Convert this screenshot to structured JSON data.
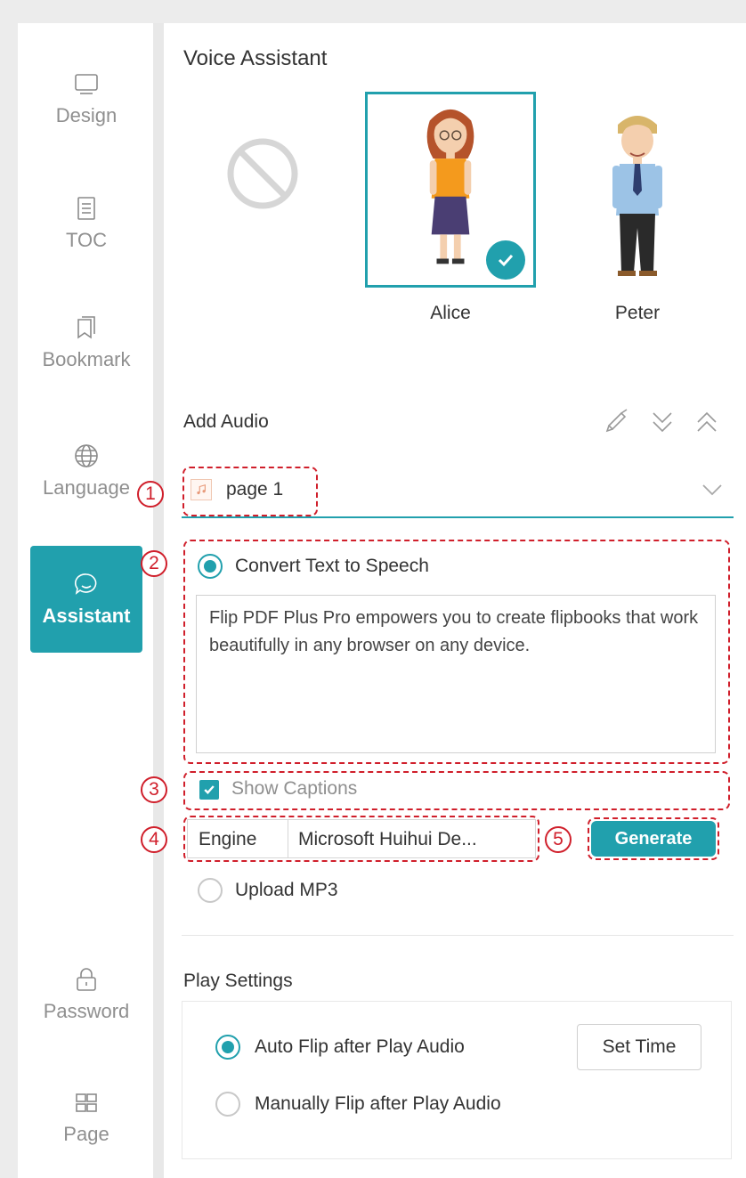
{
  "sidebar": {
    "items": [
      {
        "label": "Design",
        "icon": "monitor-icon"
      },
      {
        "label": "TOC",
        "icon": "toc-icon"
      },
      {
        "label": "Bookmark",
        "icon": "bookmark-icon"
      },
      {
        "label": "Language",
        "icon": "globe-icon"
      },
      {
        "label": "Assistant",
        "icon": "chat-bubble-icon",
        "active": true
      },
      {
        "label": "Password",
        "icon": "lock-icon"
      },
      {
        "label": "Page",
        "icon": "grid-icon"
      }
    ]
  },
  "voice_assistant": {
    "title": "Voice Assistant",
    "avatars": [
      {
        "name": "",
        "icon": "no-assistant-icon"
      },
      {
        "name": "Alice",
        "selected": true
      },
      {
        "name": "Peter"
      }
    ]
  },
  "add_audio": {
    "title": "Add Audio",
    "tools": [
      "broom-icon",
      "expand-all-icon",
      "collapse-all-icon"
    ],
    "page_select": {
      "value": "page 1",
      "icon": "music-note-icon"
    },
    "tts": {
      "label": "Convert Text to Speech",
      "selected": true,
      "text": "Flip PDF Plus Pro empowers you to create flipbooks that work beautifully in any browser on any device."
    },
    "show_captions": {
      "label": "Show Captions",
      "checked": true
    },
    "engine": {
      "label": "Engine",
      "value": "Microsoft Huihui De..."
    },
    "generate_label": "Generate",
    "upload_mp3": {
      "label": "Upload MP3",
      "selected": false
    }
  },
  "play_settings": {
    "title": "Play Settings",
    "options": [
      {
        "label": "Auto Flip after Play Audio",
        "selected": true
      },
      {
        "label": "Manually Flip after Play Audio",
        "selected": false
      }
    ],
    "set_time_label": "Set Time"
  },
  "callouts": [
    "1",
    "2",
    "3",
    "4",
    "5"
  ],
  "colors": {
    "accent": "#21a0ad",
    "annotation": "#d01f2b",
    "muted": "#8f8f8f"
  }
}
